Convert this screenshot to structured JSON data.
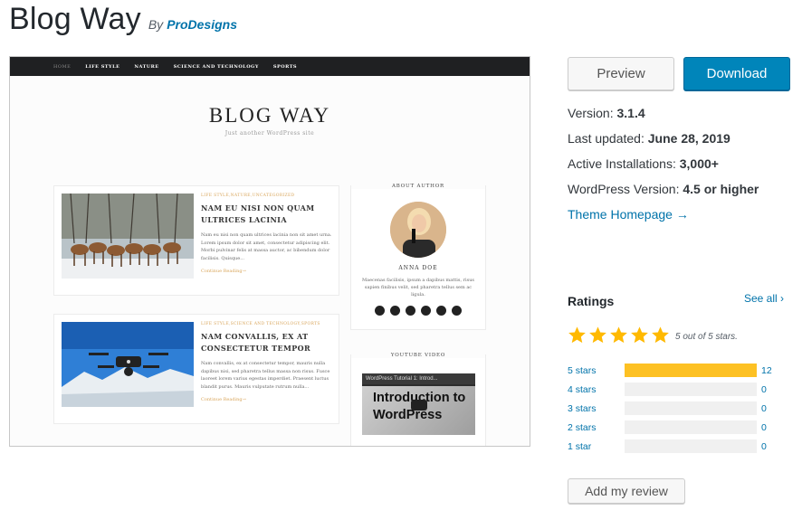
{
  "header": {
    "title": "Blog Way",
    "by": "By",
    "author": "ProDesigns"
  },
  "screenshot": {
    "nav": [
      "HOME",
      "LIFE STYLE",
      "NATURE",
      "SCIENCE AND TECHNOLOGY",
      "SPORTS"
    ],
    "blog_name": "BLOG WAY",
    "tagline": "Just another WordPress site",
    "posts": [
      {
        "cats": "LIFE STYLE,NATURE,UNCATEGORIZED",
        "title": "NAM EU NISI NON QUAM ULTRICES LACINIA",
        "excerpt": "Nam eu nisi non quam ultrices lacinia non sit amet urna. Lorem ipsum dolor sit amet, consectetur adipiscing elit. Morbi pulvinar felis at massa auctor, ac bibendum dolor facilisis. Quisque...",
        "more": "Continue Reading→"
      },
      {
        "cats": "LIFE STYLE,SCIENCE AND TECHNOLOGY,SPORTS",
        "title": "NAM CONVALLIS, EX AT CONSECTETUR TEMPOR",
        "excerpt": "Nam convallis, ex at consectetur tempor, mauris nulla dapibus nisi, sed pharetra tellus massa non risus. Fusce laoreet lorem varius egestas imperdiet. Praesent luctus blandit purus. Mauris vulputate rutrum nulla...",
        "more": "Continue Reading→"
      }
    ],
    "about": {
      "title": "ABOUT AUTHOR",
      "name": "ANNA DOE",
      "bio": "Maecenas facilisis, ipsum a dapibus mattis, risus sapien finibus velit, sed pharetra tellus sem ac ligula."
    },
    "video": {
      "title": "YOUTUBE VIDEO",
      "bar": "WordPress Tutorial 1: Introd...",
      "text": "Introduction to WordPress"
    }
  },
  "actions": {
    "preview": "Preview",
    "download": "Download"
  },
  "meta": {
    "version_label": "Version:",
    "version": "3.1.4",
    "updated_label": "Last updated:",
    "updated": "June 28, 2019",
    "installs_label": "Active Installations:",
    "installs": "3,000+",
    "wp_label": "WordPress Version:",
    "wp": "4.5 or higher",
    "homepage": "Theme Homepage →"
  },
  "ratings": {
    "heading": "Ratings",
    "see_all": "See all ›",
    "summary": "5 out of 5 stars.",
    "star_color": "#ffb900",
    "rows": [
      {
        "label": "5 stars",
        "count": "12",
        "fraction": 1.0
      },
      {
        "label": "4 stars",
        "count": "0",
        "fraction": 0
      },
      {
        "label": "3 stars",
        "count": "0",
        "fraction": 0
      },
      {
        "label": "2 stars",
        "count": "0",
        "fraction": 0
      },
      {
        "label": "1 star",
        "count": "0",
        "fraction": 0
      }
    ],
    "add_review": "Add my review"
  }
}
